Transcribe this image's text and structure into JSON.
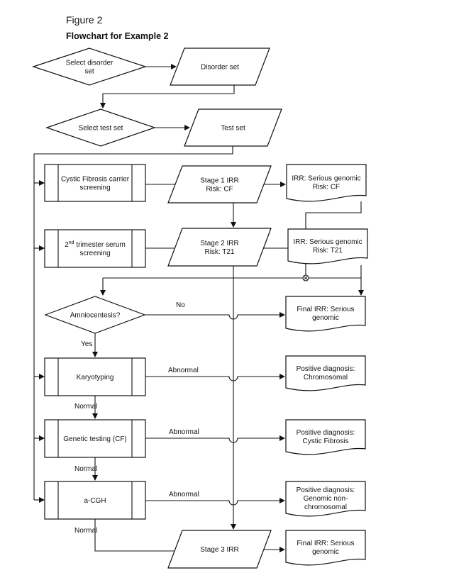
{
  "figure": {
    "label": "Figure 2",
    "title": "Flowchart for Example 2"
  },
  "nodes": {
    "select_disorder": {
      "type": "decision",
      "lines": [
        "Select disorder",
        "set"
      ]
    },
    "disorder_set": {
      "type": "data",
      "lines": [
        "Disorder set"
      ]
    },
    "select_test": {
      "type": "decision",
      "lines": [
        "Select test set"
      ]
    },
    "test_set": {
      "type": "data",
      "lines": [
        "Test set"
      ]
    },
    "cf_screening": {
      "type": "predefined-process",
      "lines": [
        "Cystic Fibrosis carrier",
        "screening"
      ]
    },
    "stage1": {
      "type": "data",
      "lines": [
        "Stage 1 IRR",
        "Risk: CF"
      ]
    },
    "irr_cf": {
      "type": "document",
      "lines": [
        "IRR: Serious genomic",
        "Risk: CF"
      ]
    },
    "serum_screening": {
      "type": "predefined-process",
      "lines": [
        "2nd trimester serum",
        "screening"
      ],
      "superscript": "nd"
    },
    "stage2": {
      "type": "data",
      "lines": [
        "Stage 2 IRR",
        "Risk: T21"
      ]
    },
    "irr_t21": {
      "type": "document",
      "lines": [
        "IRR: Serious genomic",
        "Risk: T21"
      ]
    },
    "amnio": {
      "type": "decision",
      "lines": [
        "Amniocentesis?"
      ]
    },
    "final_irr_1": {
      "type": "document",
      "lines": [
        "Final IRR: Serious",
        "genomic"
      ]
    },
    "karyotyping": {
      "type": "predefined-process",
      "lines": [
        "Karyotyping"
      ]
    },
    "pos_chromosomal": {
      "type": "document",
      "lines": [
        "Positive diagnosis:",
        "Chromosomal"
      ]
    },
    "genetic_cf": {
      "type": "predefined-process",
      "lines": [
        "Genetic testing (CF)"
      ]
    },
    "pos_cf": {
      "type": "document",
      "lines": [
        "Positive diagnosis:",
        "Cystic Fibrosis"
      ]
    },
    "acgh": {
      "type": "predefined-process",
      "lines": [
        "a-CGH"
      ]
    },
    "pos_genomic": {
      "type": "document",
      "lines": [
        "Positive diagnosis:",
        "Genomic non-",
        "chromosomal"
      ]
    },
    "stage3": {
      "type": "data",
      "lines": [
        "Stage 3 IRR"
      ]
    },
    "final_irr_2": {
      "type": "document",
      "lines": [
        "Final IRR: Serious",
        "genomic"
      ]
    }
  },
  "edge_labels": {
    "amnio_no": "No",
    "amnio_yes": "Yes",
    "karyo_abnormal": "Abnormal",
    "karyo_normal": "Normal",
    "cf_abnormal": "Abnormal",
    "cf_normal": "Normal",
    "acgh_abnormal": "Abnormal",
    "acgh_normal": "Normal"
  },
  "edges": [
    [
      "select_disorder",
      "disorder_set"
    ],
    [
      "disorder_set",
      "select_test"
    ],
    [
      "select_test",
      "test_set"
    ],
    [
      "test_set",
      "cf_screening"
    ],
    [
      "test_set",
      "serum_screening"
    ],
    [
      "test_set",
      "karyotyping"
    ],
    [
      "test_set",
      "genetic_cf"
    ],
    [
      "test_set",
      "acgh"
    ],
    [
      "cf_screening",
      "stage1"
    ],
    [
      "stage1",
      "irr_cf"
    ],
    [
      "stage1",
      "stage2"
    ],
    [
      "serum_screening",
      "stage2"
    ],
    [
      "stage2",
      "irr_t21"
    ],
    [
      "stage2",
      "stage3"
    ],
    [
      "irr_cf",
      "amnio"
    ],
    [
      "irr_t21",
      "final_irr_1"
    ],
    [
      "amnio",
      "final_irr_1",
      "No"
    ],
    [
      "amnio",
      "karyotyping",
      "Yes"
    ],
    [
      "karyotyping",
      "pos_chromosomal",
      "Abnormal"
    ],
    [
      "karyotyping",
      "genetic_cf",
      "Normal"
    ],
    [
      "genetic_cf",
      "pos_cf",
      "Abnormal"
    ],
    [
      "genetic_cf",
      "acgh",
      "Normal"
    ],
    [
      "acgh",
      "pos_genomic",
      "Abnormal"
    ],
    [
      "acgh",
      "stage3",
      "Normal"
    ],
    [
      "stage3",
      "final_irr_2"
    ]
  ]
}
